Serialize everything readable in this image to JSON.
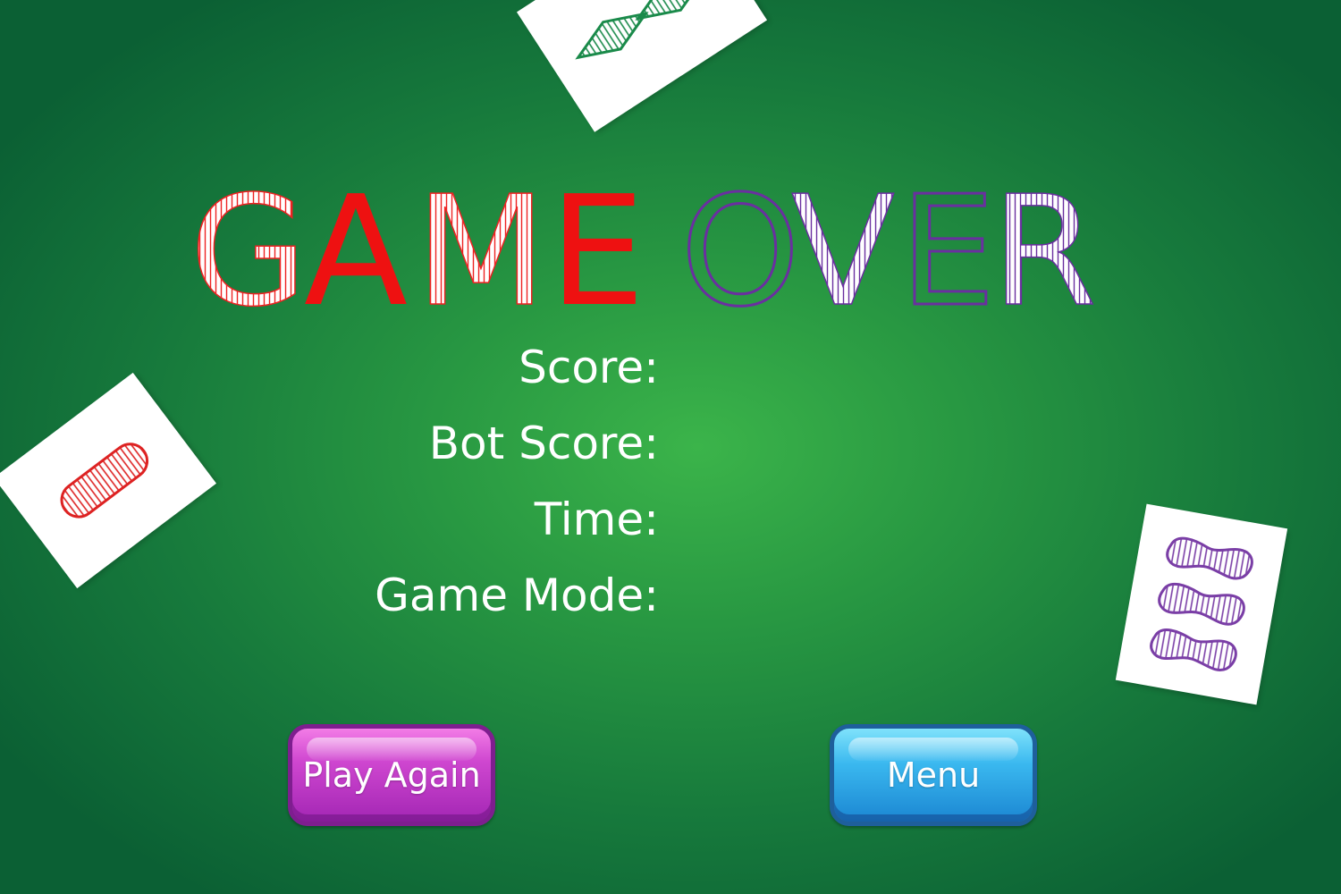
{
  "title": {
    "letters": [
      {
        "char": "G",
        "style": "striped",
        "color": "#ee2222"
      },
      {
        "char": "A",
        "style": "solid",
        "color": "#ee1111"
      },
      {
        "char": "M",
        "style": "striped",
        "color": "#ee2222"
      },
      {
        "char": "E",
        "style": "solid",
        "color": "#ee1111"
      },
      {
        "char": "O",
        "style": "outline",
        "color": "#6a2fa0"
      },
      {
        "char": "V",
        "style": "striped",
        "color": "#6a2fa0"
      },
      {
        "char": "E",
        "style": "outline",
        "color": "#6a2fa0"
      },
      {
        "char": "R",
        "style": "striped",
        "color": "#6a2fa0"
      }
    ]
  },
  "stats": {
    "score_label": "Score:",
    "bot_score_label": "Bot Score:",
    "time_label": "Time:",
    "game_mode_label": "Game Mode:"
  },
  "buttons": {
    "play_again": "Play Again",
    "menu": "Menu"
  },
  "cards": [
    {
      "shape": "diamond",
      "count": 2,
      "fill": "striped",
      "color": "#1a8a4a"
    },
    {
      "shape": "oval",
      "count": 1,
      "fill": "striped",
      "color": "#dd2222"
    },
    {
      "shape": "squiggle",
      "count": 3,
      "fill": "striped",
      "color": "#7a3ea6"
    }
  ],
  "colors": {
    "table_green": "#289842",
    "red": "#ee1111",
    "purple": "#6a2fa0",
    "green": "#1a8a4a",
    "play_button": "#c23fcc",
    "menu_button": "#2aa7e8"
  }
}
